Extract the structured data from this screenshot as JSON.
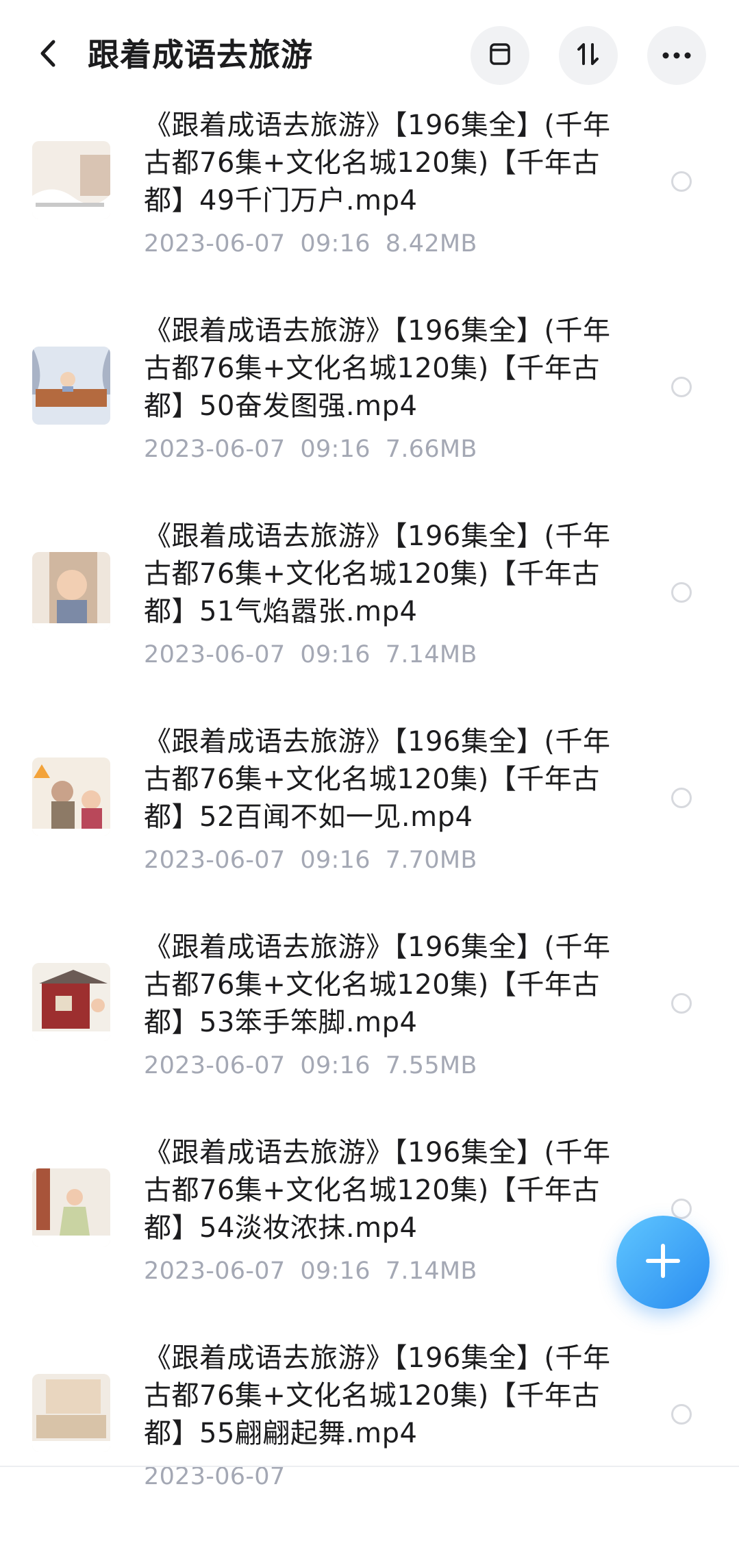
{
  "header": {
    "title": "跟着成语去旅游",
    "back_icon": "chevron-left-icon",
    "buttons": [
      {
        "name": "archive-icon"
      },
      {
        "name": "sort-icon"
      },
      {
        "name": "more-icon"
      }
    ]
  },
  "files": [
    {
      "name": "《跟着成语去旅游》【196集全】(千年古都76集+文化名城120集)【千年古都】49千门万户.mp4",
      "date": "2023-06-07",
      "time": "09:16",
      "size": "8.42MB"
    },
    {
      "name": "《跟着成语去旅游》【196集全】(千年古都76集+文化名城120集)【千年古都】50奋发图强.mp4",
      "date": "2023-06-07",
      "time": "09:16",
      "size": "7.66MB"
    },
    {
      "name": "《跟着成语去旅游》【196集全】(千年古都76集+文化名城120集)【千年古都】51气焰嚣张.mp4",
      "date": "2023-06-07",
      "time": "09:16",
      "size": "7.14MB"
    },
    {
      "name": "《跟着成语去旅游》【196集全】(千年古都76集+文化名城120集)【千年古都】52百闻不如一见.mp4",
      "date": "2023-06-07",
      "time": "09:16",
      "size": "7.70MB"
    },
    {
      "name": "《跟着成语去旅游》【196集全】(千年古都76集+文化名城120集)【千年古都】53笨手笨脚.mp4",
      "date": "2023-06-07",
      "time": "09:16",
      "size": "7.55MB"
    },
    {
      "name": "《跟着成语去旅游》【196集全】(千年古都76集+文化名城120集)【千年古都】54淡妆浓抹.mp4",
      "date": "2023-06-07",
      "time": "09:16",
      "size": "7.14MB"
    },
    {
      "name": "《跟着成语去旅游》【196集全】(千年古都76集+文化名城120集)【千年古都】55翩翩起舞.mp4",
      "date": "2023-06-07",
      "time": "",
      "size": ""
    }
  ],
  "fab": {
    "icon": "plus-icon"
  },
  "colors": {
    "meta_text": "#a4a8b4",
    "fab_start": "#5fc6ff",
    "fab_end": "#2a8cf0"
  }
}
